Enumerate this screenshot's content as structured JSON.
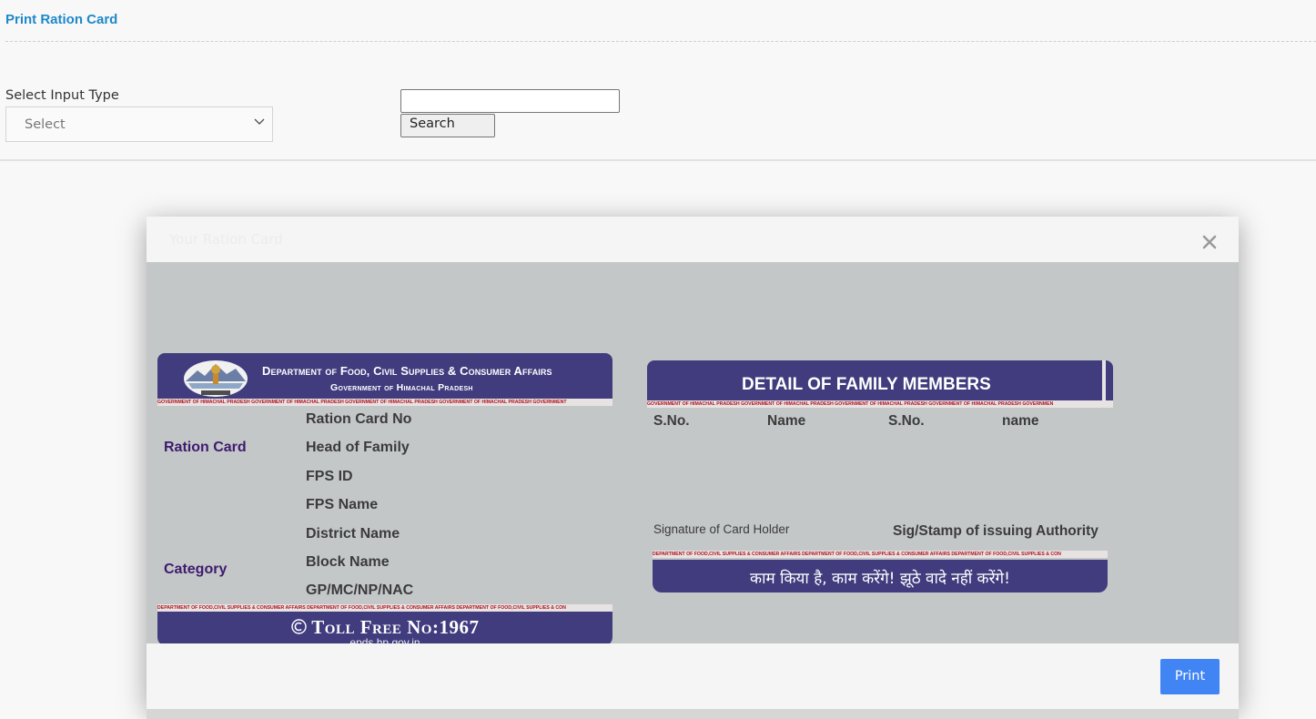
{
  "page": {
    "title": "Print Ration Card",
    "input_type_label": "Select Input Type",
    "select_value": "Select",
    "search_input_value": "",
    "search_button": "Search"
  },
  "modal": {
    "title": "Your Ration Card",
    "print_button": "Print",
    "front_card": {
      "department_title": "Department of Food, Civil Supplies & Consumer Affairs",
      "government": "Government of Himachal Pradesh",
      "header_ticker": "GOVERNMENT OF HIMACHAL PRADESH GOVERNMENT OF HIMACHAL PRADESH GOVERNMENT OF HIMACHAL PRADESH GOVERNMENT OF HIMACHAL PRADESH GOVERNMENT",
      "side_labels": [
        "Ration Card",
        "Category"
      ],
      "fields": [
        "Ration Card No",
        "Head of Family",
        "FPS ID",
        "FPS Name",
        "District Name",
        "Block Name",
        "GP/MC/NP/NAC"
      ],
      "footer_ticker": "DEPARTMENT OF FOOD,CIVIL SUPPLIES & CONSUMER AFFAIRS DEPARTMENT OF FOOD,CIVIL SUPPLIES & CONSUMER AFFAIRS DEPARTMENT OF FOOD,CIVIL SUPPLIES & CON",
      "toll_free": "Toll Free No:1967",
      "website": "epds.hp.gov.in"
    },
    "back_card": {
      "title": "DETAIL OF FAMILY MEMBERS",
      "header_ticker": "GOVERNMENT OF HIMACHAL PRADESH GOVERNMENT OF HIMACHAL PRADESH GOVERNMENT OF HIMACHAL PRADESH GOVERNMENT OF HIMACHAL PRADESH GOVERNMEN",
      "columns": [
        "S.No.",
        "Name",
        "S.No.",
        "name"
      ],
      "signature_holder": "Signature of Card Holder",
      "signature_authority": "Sig/Stamp of issuing Authority",
      "footer_ticker": "DEPARTMENT OF FOOD,CIVIL SUPPLIES & CONSUMER AFFAIRS DEPARTMENT OF FOOD,CIVIL SUPPLIES & CONSUMER AFFAIRS DEPARTMENT OF FOOD,CIVIL SUPPLIES & CON",
      "slogan": "काम किया है, काम करेंगे! झूठे वादे नहीं करेंगे!"
    }
  }
}
